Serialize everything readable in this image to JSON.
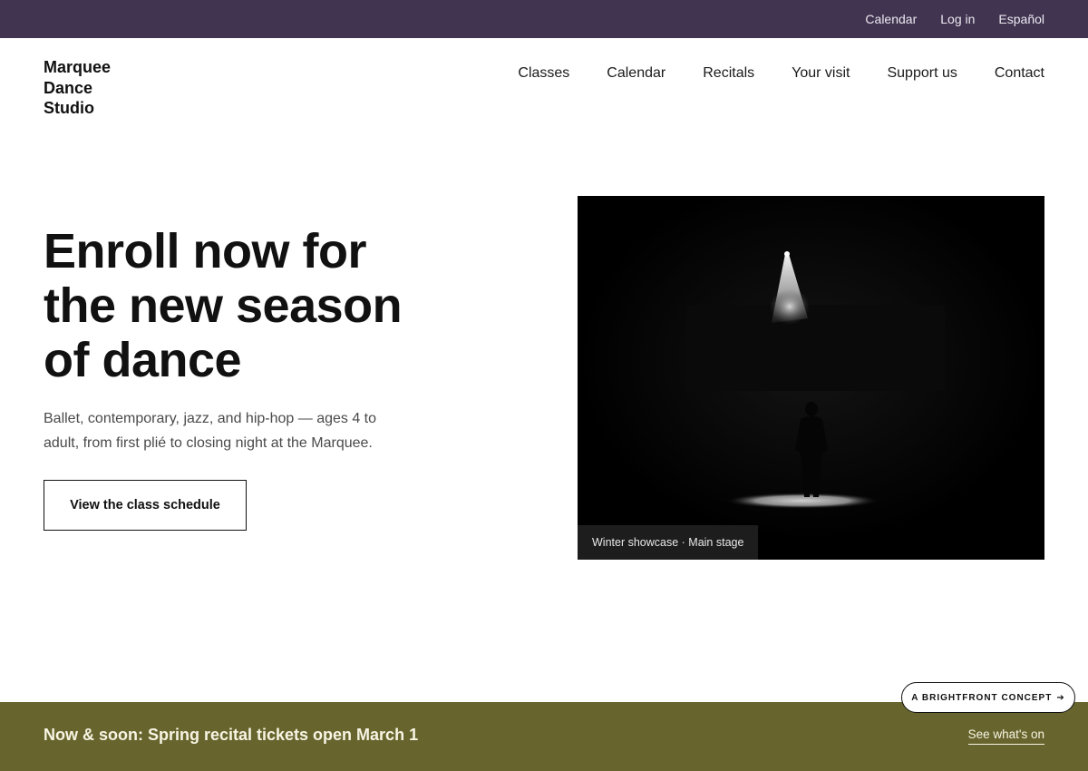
{
  "utility_nav": [
    "Calendar",
    "Log in",
    "Español"
  ],
  "logo": {
    "line1": "Marquee",
    "line2": "Dance",
    "line3": "Studio"
  },
  "main_nav": [
    "Classes",
    "Calendar",
    "Recitals",
    "Your visit",
    "Support us",
    "Contact"
  ],
  "hero": {
    "title": "Enroll now for the new season of dance",
    "description": "Ballet, contemporary, jazz, and hip-hop — ages 4 to adult, from first plié to closing night at the Marquee.",
    "cta_label": "View the class schedule",
    "image_caption": "Winter showcase · Main stage"
  },
  "badge": {
    "label": "A BRIGHTFRONT CONCEPT",
    "arrow": "➔"
  },
  "announcement": {
    "text": "Now & soon: Spring recital tickets open March 1",
    "link_label": "See what's on"
  },
  "colors": {
    "utility_bar": "#413450",
    "announcement_bar": "#67652d"
  }
}
